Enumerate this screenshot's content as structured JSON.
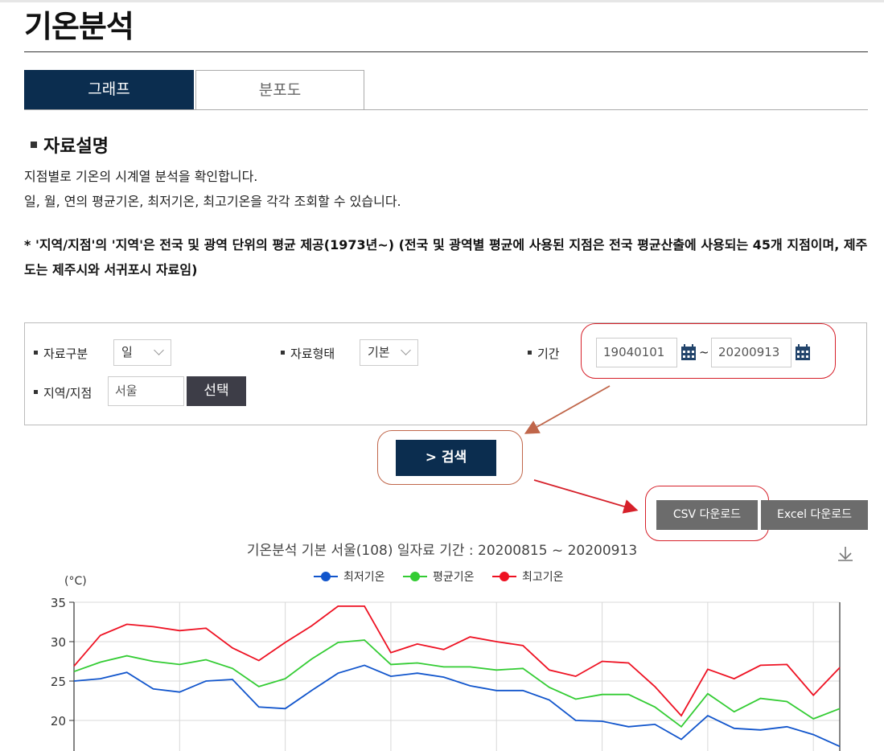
{
  "page": {
    "title": "기온분석"
  },
  "tabs": [
    {
      "label": "그래프",
      "active": true
    },
    {
      "label": "분포도",
      "active": false
    }
  ],
  "section": {
    "heading": "자료설명",
    "desc1": "지점별로 기온의 시계열 분석을 확인합니다.",
    "desc2": "일, 월, 연의 평균기온, 최저기온, 최고기온을 각각 조회할 수 있습니다.",
    "note": "* '지역/지점'의 '지역'은 전국 및 광역 단위의 평균 제공(1973년~) (전국 및 광역별 평균에 사용된 지점은 전국 평균산출에 사용되는 45개 지점이며, 제주도는 제주시와 서귀포시 자료임)"
  },
  "form": {
    "data_type_label": "자료구분",
    "data_type_value": "일",
    "data_form_label": "자료형태",
    "data_form_value": "기본",
    "period_label": "기간",
    "start_date": "19040101",
    "tilde": "~",
    "end_date": "20200913",
    "station_label": "지역/지점",
    "station_value": "서울",
    "select_button": "선택",
    "search_button": "> 검색"
  },
  "downloads": {
    "csv": "CSV 다운로드",
    "excel": "Excel 다운로드"
  },
  "icons": {
    "calendar": "calendar-icon",
    "download": "download-icon",
    "chevron": "chevron-down-icon"
  },
  "colors": {
    "navy": "#0b2d4f",
    "min": "#1155cc",
    "avg": "#33cc33",
    "max": "#ee1122",
    "annotation_red": "#d6202a",
    "annotation_orange": "#c0664a"
  },
  "chart_data": {
    "type": "line",
    "title": "기온분석 기본 서울(108) 일자료 기간 : 20200815 ~ 20200913",
    "ylabel": "(°C)",
    "yticks": [
      "35",
      "30",
      "25",
      "20"
    ],
    "ylim": [
      16.4,
      35
    ],
    "grid": true,
    "legend_position": "top-center",
    "series": [
      {
        "name": "최저기온",
        "color": "#1155cc",
        "values": [
          25.0,
          25.3,
          26.1,
          24.0,
          23.6,
          25.0,
          25.2,
          21.7,
          21.5,
          23.8,
          26.0,
          27.0,
          25.6,
          26.0,
          25.5,
          24.4,
          23.8,
          23.8,
          22.6,
          20.0,
          19.9,
          19.2,
          19.5,
          17.6,
          20.6,
          19.0,
          18.8,
          19.2,
          18.2,
          16.7
        ]
      },
      {
        "name": "평균기온",
        "color": "#33cc33",
        "values": [
          26.2,
          27.4,
          28.2,
          27.5,
          27.1,
          27.7,
          26.6,
          24.3,
          25.3,
          27.8,
          29.9,
          30.2,
          27.1,
          27.3,
          26.8,
          26.8,
          26.4,
          26.6,
          24.2,
          22.7,
          23.3,
          23.3,
          21.7,
          19.2,
          23.4,
          21.1,
          22.8,
          22.4,
          20.2,
          21.5
        ]
      },
      {
        "name": "최고기온",
        "color": "#ee1122",
        "values": [
          26.9,
          30.8,
          32.2,
          31.9,
          31.4,
          31.7,
          29.2,
          27.6,
          29.9,
          32.0,
          34.5,
          34.5,
          28.6,
          29.7,
          29.0,
          30.6,
          30.0,
          29.5,
          26.4,
          25.6,
          27.5,
          27.3,
          24.3,
          20.6,
          26.5,
          25.3,
          27.0,
          27.1,
          23.2,
          26.7
        ]
      }
    ]
  }
}
